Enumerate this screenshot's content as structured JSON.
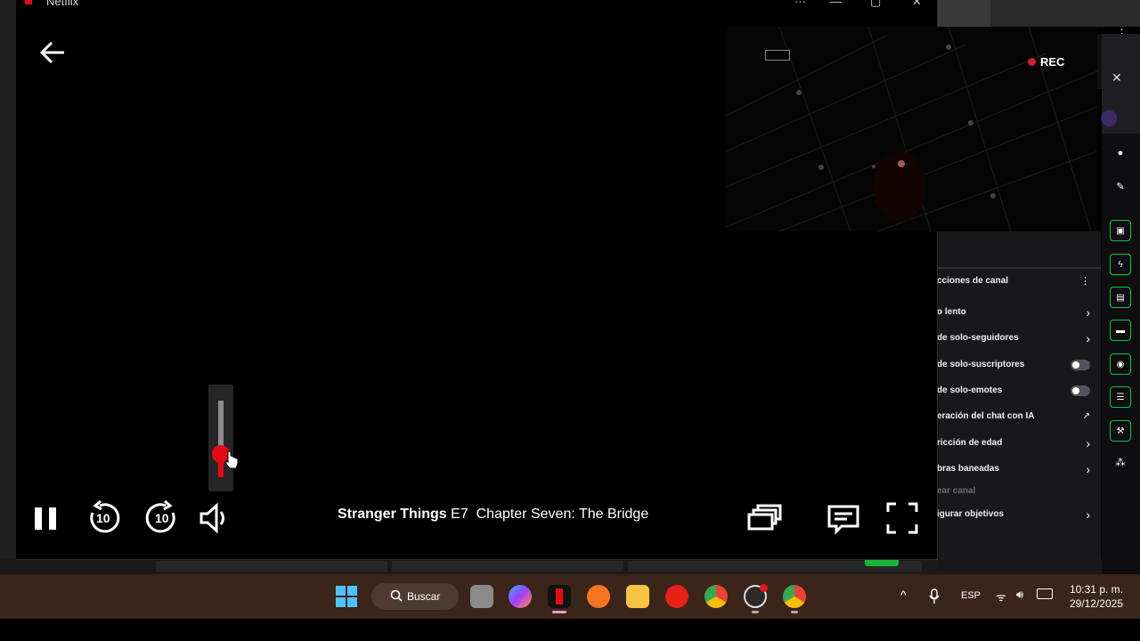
{
  "window": {
    "title": "Netflix",
    "controls": [
      "···",
      "—",
      "▢",
      "✕"
    ]
  },
  "overlay": {
    "rec_label": "REC"
  },
  "player": {
    "show": "Stranger Things",
    "episode": "E7",
    "episode_title": "Chapter Seven: The Bridge",
    "skip_back_label": "10",
    "skip_fwd_label": "10",
    "volume_level": 0.3
  },
  "chat_panel": {
    "header": "cciones de canal",
    "header_menu": "⋮",
    "rows": [
      {
        "label": "o lento",
        "control": "chevron"
      },
      {
        "label": "de solo-seguidores",
        "control": "chevron"
      },
      {
        "label": "de solo-suscriptores",
        "control": "toggle"
      },
      {
        "label": "de solo-emotes",
        "control": "toggle"
      },
      {
        "label": "eración del chat con IA",
        "control": "external"
      },
      {
        "label": "ricción de edad",
        "control": "chevron"
      },
      {
        "label": "bras baneadas",
        "control": "chevron"
      },
      {
        "label": "ear canal",
        "control": "none"
      },
      {
        "label": "igurar objetivos",
        "control": "chevron"
      }
    ],
    "close": "✕"
  },
  "taskbar": {
    "search_label": "Buscar",
    "language": "ESP",
    "time": "10:31 p. m.",
    "date": "29/12/2025",
    "colors": {
      "taskbar": "#3b2419",
      "accent": "#e50914"
    }
  }
}
